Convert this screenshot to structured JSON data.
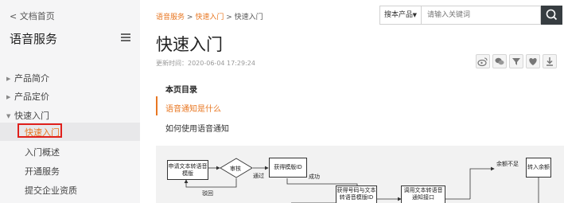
{
  "sidebar": {
    "back_link": "< 文档首页",
    "title": "语音服务",
    "items": [
      {
        "label": "产品简介"
      },
      {
        "label": "产品定价"
      },
      {
        "label": "快速入门"
      }
    ],
    "subitems": [
      {
        "label": "快速入门"
      },
      {
        "label": "入门概述"
      },
      {
        "label": "开通服务"
      },
      {
        "label": "提交企业资质"
      }
    ]
  },
  "breadcrumb": {
    "part1": "语音服务",
    "part2": "快速入门",
    "sep": ">",
    "current": "快速入门"
  },
  "search": {
    "scope_label": "搜本产品",
    "placeholder": "请输入关键词"
  },
  "article": {
    "title": "快速入门",
    "updated_label": "更新时间：",
    "updated_time": "2020-06-04 17:29:24"
  },
  "toc": {
    "title": "本页目录",
    "items": [
      {
        "label": "语音通知是什么"
      },
      {
        "label": "如何使用语音通知"
      }
    ]
  },
  "flow": {
    "apply_tpl": "申请文本转语音模版",
    "review": "审核",
    "pass": "通过",
    "reject": "驳回",
    "get_tpl": "获得模版ID",
    "success": "成功",
    "get_num": "获得号码与文本转语音模版ID",
    "call_api": "调用文本转语音通知接口",
    "insufficient": "余额不足",
    "topup": "转入余额"
  },
  "colors": {
    "accent": "#e87722",
    "highlight_border": "#e0201c",
    "search_button": "#373d41"
  }
}
